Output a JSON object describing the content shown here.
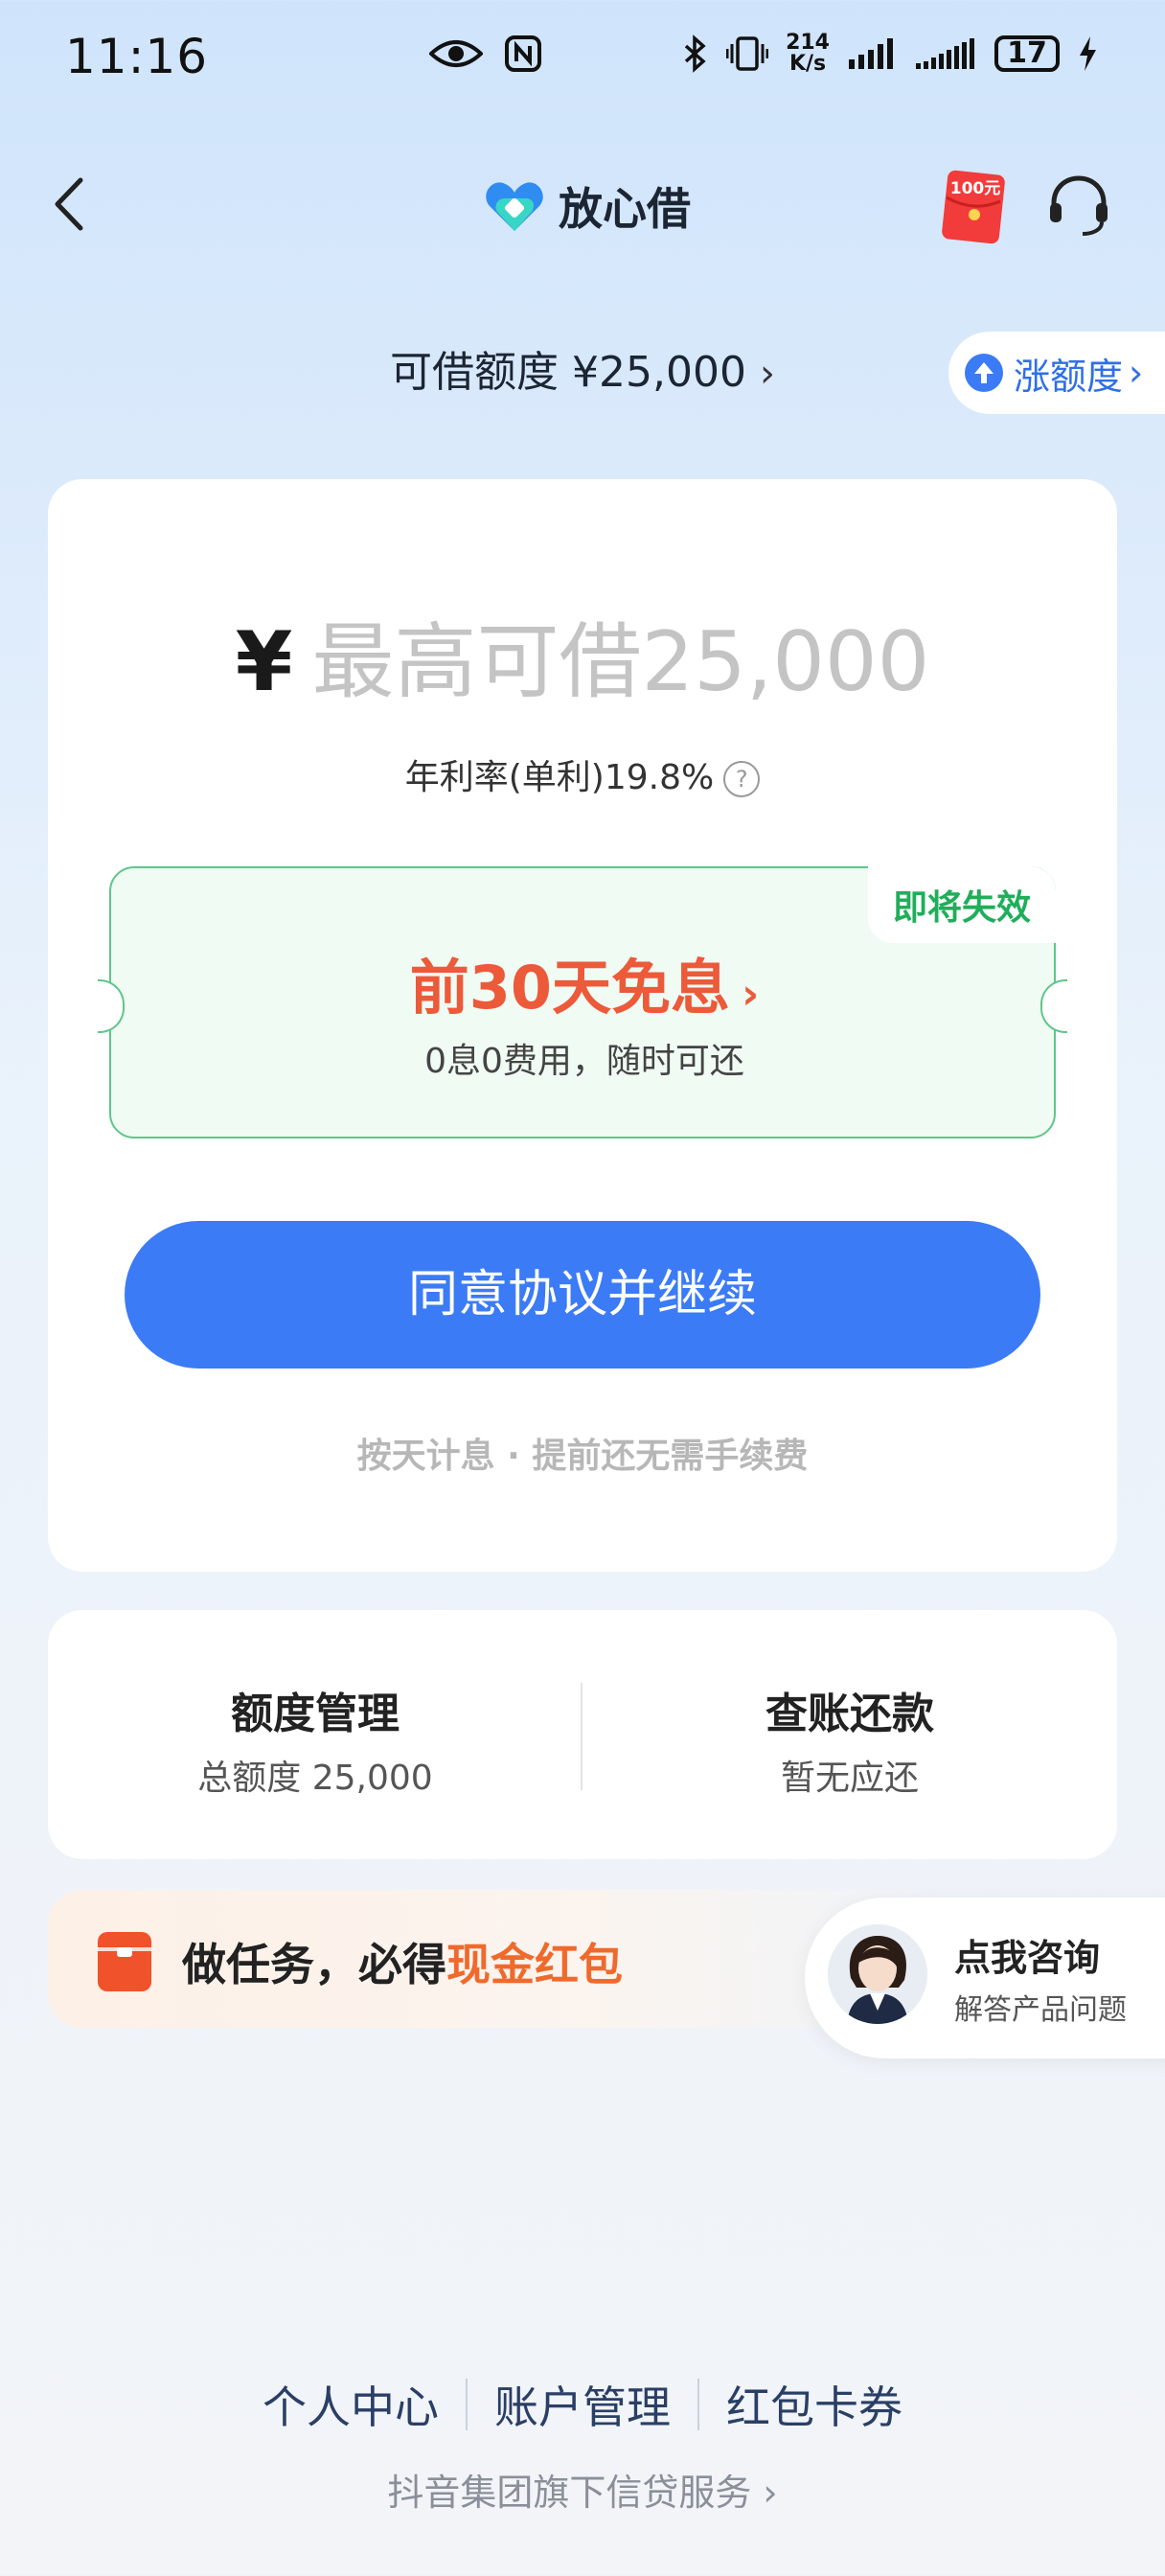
{
  "status_bar": {
    "time": "11:16",
    "net_speed_value": "214",
    "net_speed_unit": "K/s",
    "battery": "17"
  },
  "header": {
    "app_title": "放心借",
    "redpack_label": "100元"
  },
  "quota": {
    "label": "可借额度 ¥25,000",
    "raise_label": "涨额度"
  },
  "loan": {
    "currency": "¥",
    "placeholder": "最高可借25,000",
    "rate_text": "年利率(单利)19.8%"
  },
  "coupon": {
    "tag": "即将失效",
    "title": "前30天免息",
    "subtitle": "0息0费用，随时可还"
  },
  "agree_button": "同意协议并继续",
  "note": "按天计息 · 提前还无需手续费",
  "manage": {
    "left_title": "额度管理",
    "left_sub": "总额度 25,000",
    "right_title": "查账还款",
    "right_sub": "暂无应还"
  },
  "task": {
    "text_prefix": "做任务，必得",
    "text_highlight": "现金红包"
  },
  "consult": {
    "title": "点我咨询",
    "subtitle": "解答产品问题"
  },
  "footer": {
    "links": [
      "个人中心",
      "账户管理",
      "红包卡券"
    ],
    "note": "抖音集团旗下信贷服务"
  },
  "colors": {
    "primary": "#3b7bf6",
    "coupon_title": "#ec5a3a",
    "coupon_tag": "#1fae5a",
    "highlight": "#ef6a2c"
  },
  "icons": [
    "back-arrow-icon",
    "logo-icon",
    "redpack-icon",
    "headset-icon",
    "raise-quota-icon",
    "help-icon",
    "gift-icon",
    "chevron-right-icon",
    "bluetooth-icon",
    "vibrate-icon",
    "nfc-icon",
    "eye-icon",
    "signal-icon",
    "charging-icon"
  ]
}
